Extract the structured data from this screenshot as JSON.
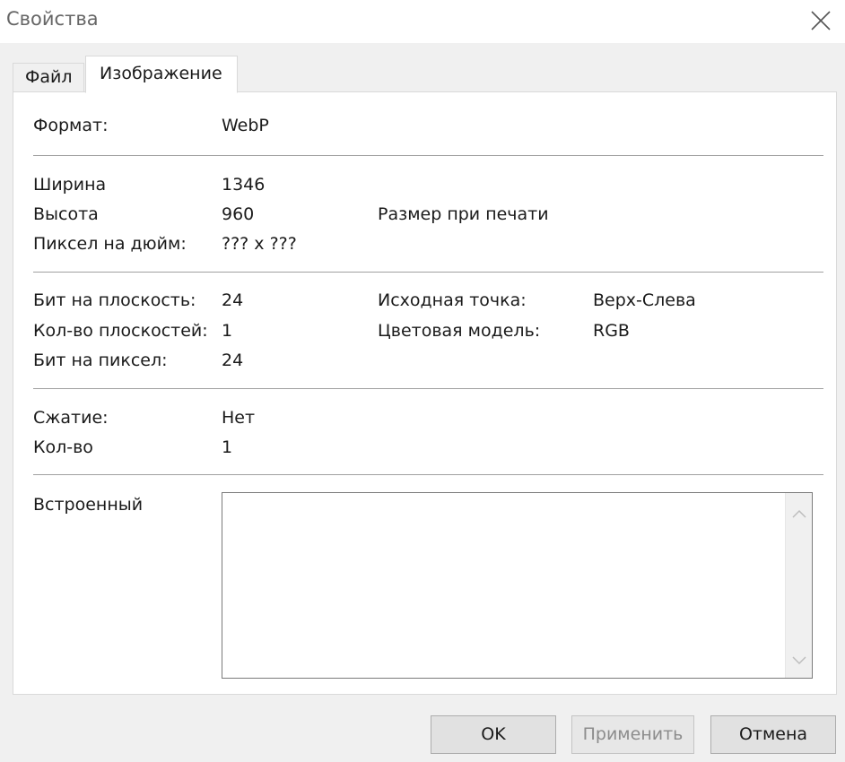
{
  "window": {
    "title": "Свойства"
  },
  "tabs": [
    {
      "label": "Файл",
      "active": false
    },
    {
      "label": "Изображение",
      "active": true
    }
  ],
  "format": {
    "label": "Формат:",
    "value": "WebP"
  },
  "dimensions": {
    "width_label": "Ширина",
    "width_value": "1346",
    "height_label": "Высота",
    "height_value": "960",
    "dpi_label": "Пиксел на дюйм:",
    "dpi_value": "??? x ???",
    "print_size_label": "Размер при печати"
  },
  "bits": {
    "bits_per_plane_label": "Бит на плоскость:",
    "bits_per_plane_value": "24",
    "planes_label": "Кол-во плоскостей:",
    "planes_value": "1",
    "bits_per_pixel_label": "Бит на пиксел:",
    "bits_per_pixel_value": "24",
    "origin_label": "Исходная точка:",
    "origin_value": "Верх-Слева",
    "color_model_label": "Цветовая модель:",
    "color_model_value": "RGB"
  },
  "compression": {
    "compression_label": "Сжатие:",
    "compression_value": "Нет",
    "count_label": "Кол-во",
    "count_value": "1"
  },
  "embedded": {
    "label": "Встроенный",
    "value": ""
  },
  "buttons": {
    "ok": "OK",
    "apply": "Применить",
    "cancel": "Отмена"
  },
  "icons": {
    "close": "close-icon",
    "scroll_up": "chevron-up-icon",
    "scroll_down": "chevron-down-icon"
  }
}
